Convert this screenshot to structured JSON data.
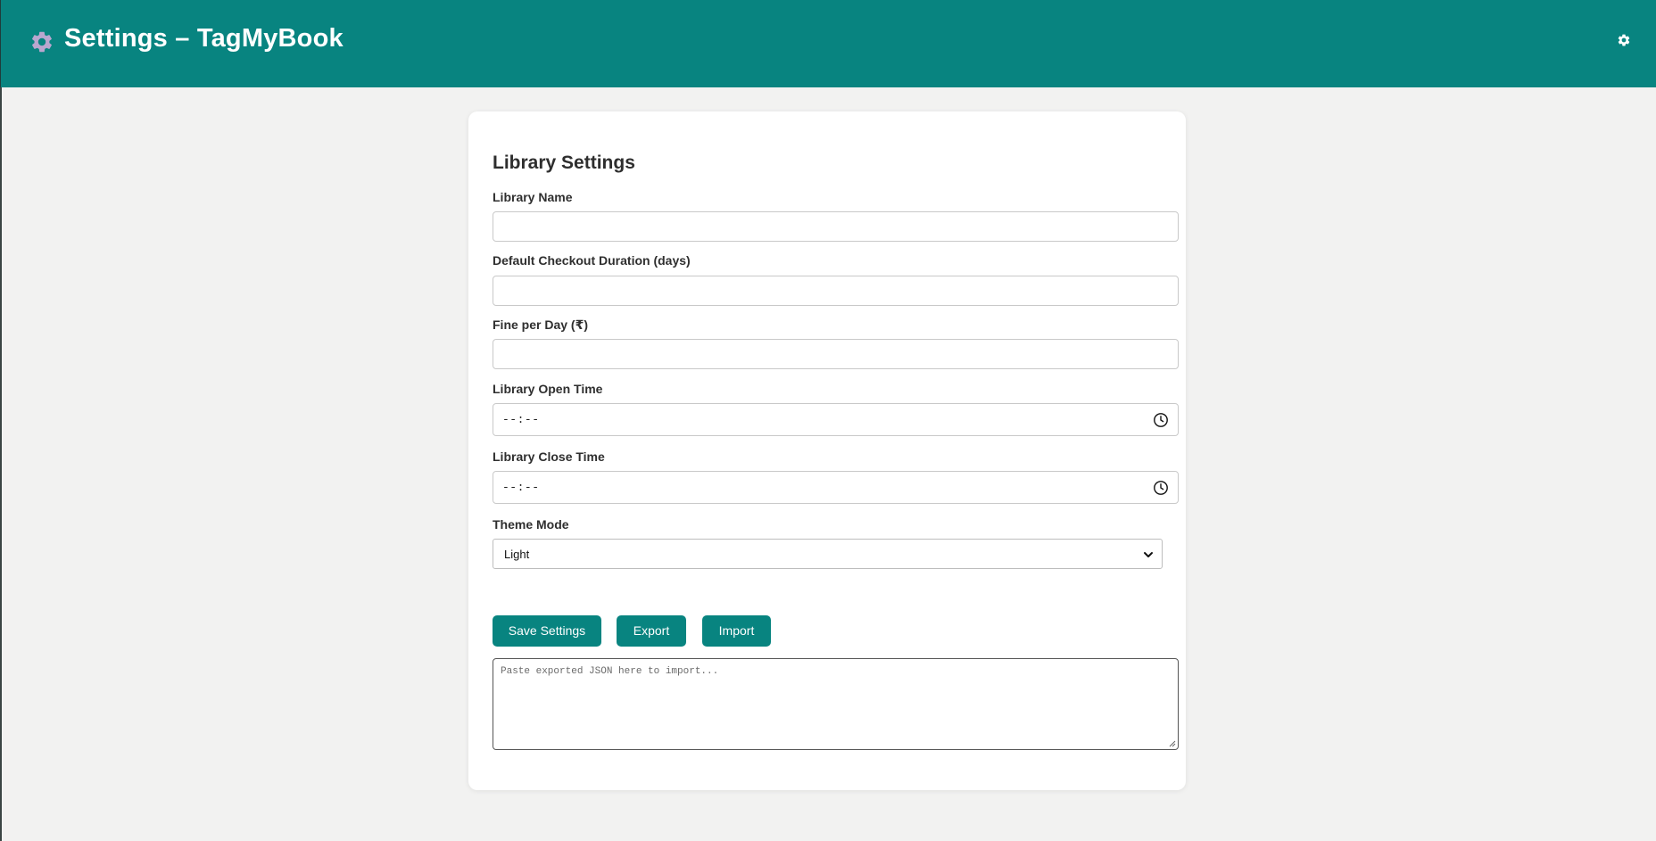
{
  "header": {
    "title": "Settings – TagMyBook",
    "left_icon": "gear-icon",
    "right_icon": "gear-icon",
    "color": "#088480"
  },
  "form": {
    "title": "Library Settings",
    "library_name_label": "Library Name",
    "library_name_value": "",
    "checkout_duration_label": "Default Checkout Duration (days)",
    "checkout_duration_value": "",
    "fine_label": "Fine per Day (₹)",
    "fine_value": "",
    "open_time_label": "Library Open Time",
    "open_time_value": "--:--",
    "close_time_label": "Library Close Time",
    "close_time_value": "--:--",
    "theme_label": "Theme Mode",
    "theme_value": "Light"
  },
  "buttons": {
    "save": "Save Settings",
    "export": "Export",
    "import": "Import"
  },
  "import_area": {
    "placeholder": "Paste exported JSON here to import..."
  }
}
